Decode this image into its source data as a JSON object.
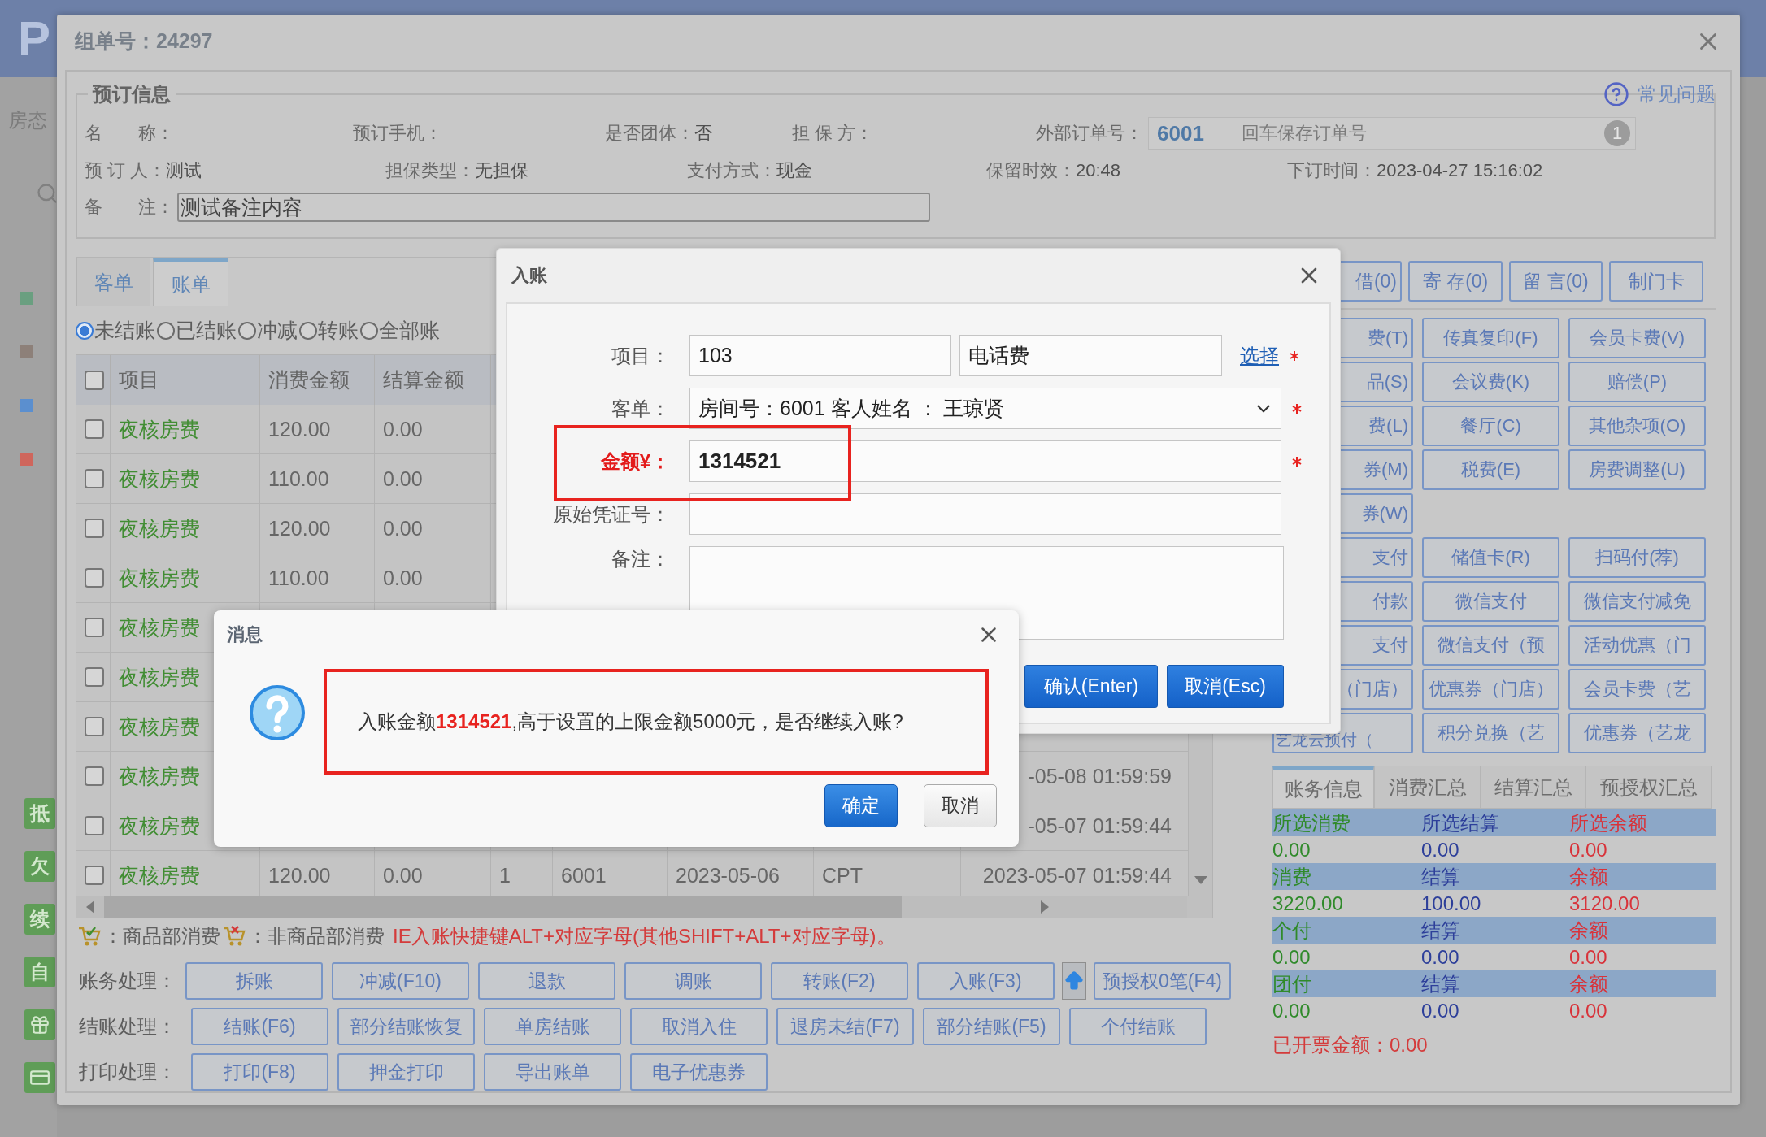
{
  "page": {
    "logo": "P",
    "nav_label": "房态",
    "room_marks": [
      {
        "color": "#6a9f80"
      },
      {
        "color": "#8d8079"
      },
      {
        "color": "#5b8fcf"
      },
      {
        "color": "#cf665c"
      }
    ],
    "side_tags": [
      {
        "kind": "text",
        "label": "抵"
      },
      {
        "kind": "text",
        "label": "欠"
      },
      {
        "kind": "text",
        "label": "续"
      },
      {
        "kind": "text",
        "label": "自"
      },
      {
        "kind": "gift"
      },
      {
        "kind": "card"
      }
    ]
  },
  "window": {
    "title": "组单号：24297",
    "help_link": "常见问题"
  },
  "booking": {
    "legend": "预订信息",
    "rows": [
      {
        "items": [
          {
            "kind": "text",
            "label": "名　　称："
          },
          {
            "kind": "text",
            "label": "预订手机："
          },
          {
            "kind": "text",
            "label": "是否团体：",
            "value": "否"
          },
          {
            "kind": "text",
            "label": "担 保 方："
          },
          {
            "kind": "order_field",
            "label": "外部订单号：",
            "value": "6001",
            "hint": "回车保存订单号",
            "badge": "1"
          }
        ]
      },
      {
        "items": [
          {
            "kind": "text",
            "label": "预 订 人：",
            "value": "测试"
          },
          {
            "kind": "text",
            "label": "担保类型：",
            "value": "无担保"
          },
          {
            "kind": "text",
            "label": "支付方式：",
            "value": "现金"
          },
          {
            "kind": "text",
            "label": "保留时效：",
            "value": "20:48"
          },
          {
            "kind": "text",
            "label": "下订时间：",
            "value": "2023-04-27 15:16:02"
          }
        ]
      },
      {
        "items": [
          {
            "kind": "input",
            "label": "备　　注：",
            "value": "测试备注内容"
          }
        ]
      }
    ]
  },
  "bill": {
    "tabs": [
      {
        "label": "客单",
        "selected": false
      },
      {
        "label": "账单",
        "selected": true
      }
    ],
    "filters": [
      {
        "label": "未结账",
        "selected": true
      },
      {
        "label": "已结账",
        "selected": false
      },
      {
        "label": "冲减",
        "selected": false
      },
      {
        "label": "转账",
        "selected": false
      },
      {
        "label": "全部账",
        "selected": false
      }
    ],
    "table": {
      "select_all_checked": false,
      "columns": [
        "项目",
        "消费金额",
        "结算金额"
      ],
      "rows": [
        {
          "checked": false,
          "item": "夜核房费",
          "consumption": "120.00",
          "settlement": "0.00"
        },
        {
          "checked": false,
          "item": "夜核房费",
          "consumption": "110.00",
          "settlement": "0.00"
        },
        {
          "checked": false,
          "item": "夜核房费",
          "consumption": "120.00",
          "settlement": "0.00"
        },
        {
          "checked": false,
          "item": "夜核房费",
          "consumption": "110.00",
          "settlement": "0.00"
        },
        {
          "checked": false,
          "item": "夜核房费"
        },
        {
          "checked": false,
          "item": "夜核房费"
        },
        {
          "checked": false,
          "item": "夜核房费"
        },
        {
          "checked": false,
          "item": "夜核房费",
          "column_9": "-05-08 01:59:59"
        },
        {
          "checked": false,
          "item": "夜核房费",
          "column_9": "-05-07 01:59:44"
        },
        {
          "checked": false,
          "item": "夜核房费",
          "consumption": "120.00",
          "settlement": "0.00",
          "column_5": "1",
          "column_6": "6001",
          "column_7": "2023-05-06",
          "column_8": "CPT",
          "column_9": "2023-05-07 01:59:44"
        }
      ]
    },
    "legend": {
      "goods": "：商品部消费",
      "non_goods": "：非商品部消费",
      "hint": "IE入账快捷键ALT+对应字母(其他SHIFT+ALT+对应字母)。"
    },
    "actions": [
      {
        "label": "账务处理：",
        "buttons": [
          {
            "kind": "text",
            "label": "拆账"
          },
          {
            "kind": "text",
            "label": "冲减(F10)"
          },
          {
            "kind": "text",
            "label": "退款"
          },
          {
            "kind": "text",
            "label": "调账"
          },
          {
            "kind": "text",
            "label": "转账(F2)"
          },
          {
            "kind": "text",
            "label": "入账(F3)"
          },
          {
            "kind": "upload"
          },
          {
            "kind": "text",
            "label": "预授权0笔(F4)"
          }
        ]
      },
      {
        "label": "结账处理：",
        "buttons": [
          {
            "kind": "text",
            "label": "结账(F6)"
          },
          {
            "kind": "text",
            "label": "部分结账恢复"
          },
          {
            "kind": "text",
            "label": "单房结账"
          },
          {
            "kind": "text",
            "label": "取消入住"
          },
          {
            "kind": "text",
            "label": "退房未结(F7)"
          },
          {
            "kind": "text",
            "label": "部分结账(F5)"
          },
          {
            "kind": "text",
            "label": "个付结账"
          }
        ]
      },
      {
        "label": "打印处理：",
        "buttons": [
          {
            "kind": "text",
            "label": "打印(F8)"
          },
          {
            "kind": "text",
            "label": "押金打印"
          },
          {
            "kind": "text",
            "label": "导出账单"
          },
          {
            "kind": "text",
            "label": "电子优惠券"
          }
        ]
      }
    ]
  },
  "side_panel": {
    "top_buttons": [
      "借(0)",
      "寄 存(0)",
      "留 言(0)",
      "制门卡"
    ],
    "button_rows": [
      {
        "buttons": [
          "费(T)",
          "传真复印(F)",
          "会员卡费(V)"
        ]
      },
      {
        "buttons": [
          "品(S)",
          "会议费(K)",
          "赔偿(P)"
        ]
      },
      {
        "buttons": [
          "费(L)",
          "餐厅(C)",
          "其他杂项(O)"
        ]
      },
      {
        "buttons": [
          "券(M)",
          "税费(E)",
          "房费调整(U)"
        ]
      },
      {
        "buttons": [
          "券(W)"
        ]
      },
      {
        "buttons": [
          "支付",
          "储值卡(R)",
          "扫码付(荐)"
        ]
      },
      {
        "buttons": [
          "付款",
          "微信支付",
          "微信支付减免"
        ]
      },
      {
        "buttons": [
          "支付",
          "微信支付（预",
          "活动优惠（门"
        ]
      },
      {
        "buttons": [
          "（门店）",
          "优惠券（门店）",
          "会员卡费（艺"
        ]
      },
      {
        "buttons": [
          "艺龙云预付（",
          "积分兑换（艺",
          "优惠券（艺龙"
        ]
      }
    ],
    "summary": {
      "tabs": [
        {
          "label": "账务信息",
          "selected": true
        },
        {
          "label": "消费汇总",
          "selected": false
        },
        {
          "label": "结算汇总",
          "selected": false
        },
        {
          "label": "预授权汇总",
          "selected": false
        }
      ],
      "rows": [
        {
          "kind": "header",
          "cells": [
            "所选消费",
            "所选结算",
            "所选余额"
          ]
        },
        {
          "kind": "value",
          "cells": [
            "0.00",
            "0.00",
            "0.00"
          ]
        },
        {
          "kind": "header",
          "cells": [
            "消费",
            "结算",
            "余额"
          ]
        },
        {
          "kind": "value",
          "cells": [
            "3220.00",
            "100.00",
            "3120.00"
          ]
        },
        {
          "kind": "header",
          "cells": [
            "个付",
            "结算",
            "余额"
          ]
        },
        {
          "kind": "value",
          "cells": [
            "0.00",
            "0.00",
            "0.00"
          ]
        },
        {
          "kind": "header",
          "cells": [
            "团付",
            "结算",
            "余额"
          ]
        },
        {
          "kind": "value",
          "cells": [
            "0.00",
            "0.00",
            "0.00"
          ]
        }
      ],
      "invoiced": "已开票金额：0.00"
    }
  },
  "entry_dialog": {
    "title": "入账",
    "fields": [
      {
        "kind": "item_picker",
        "label": "项目：",
        "code": "103",
        "name": "电话费",
        "link": "选择",
        "required": true
      },
      {
        "kind": "select",
        "label": "客单：",
        "value": "房间号：6001 客人姓名 ： 王琼贤",
        "required": true
      },
      {
        "kind": "amount",
        "label": "金额¥：",
        "value": "1314521",
        "required": true,
        "highlighted": true
      },
      {
        "kind": "text",
        "label": "原始凭证号：",
        "required": false
      },
      {
        "kind": "textarea",
        "label": "备注：",
        "required": false
      }
    ],
    "buttons": [
      {
        "label": "确认(Enter)"
      },
      {
        "label": "取消(Esc)"
      }
    ]
  },
  "message_dialog": {
    "title": "消息",
    "text": "入账金额**1314521**,高于设置的上限金额5000元，是否继续入账?",
    "highlighted": true,
    "buttons": [
      {
        "label": "确定",
        "primary": true
      },
      {
        "label": "取消",
        "primary": false
      }
    ]
  }
}
